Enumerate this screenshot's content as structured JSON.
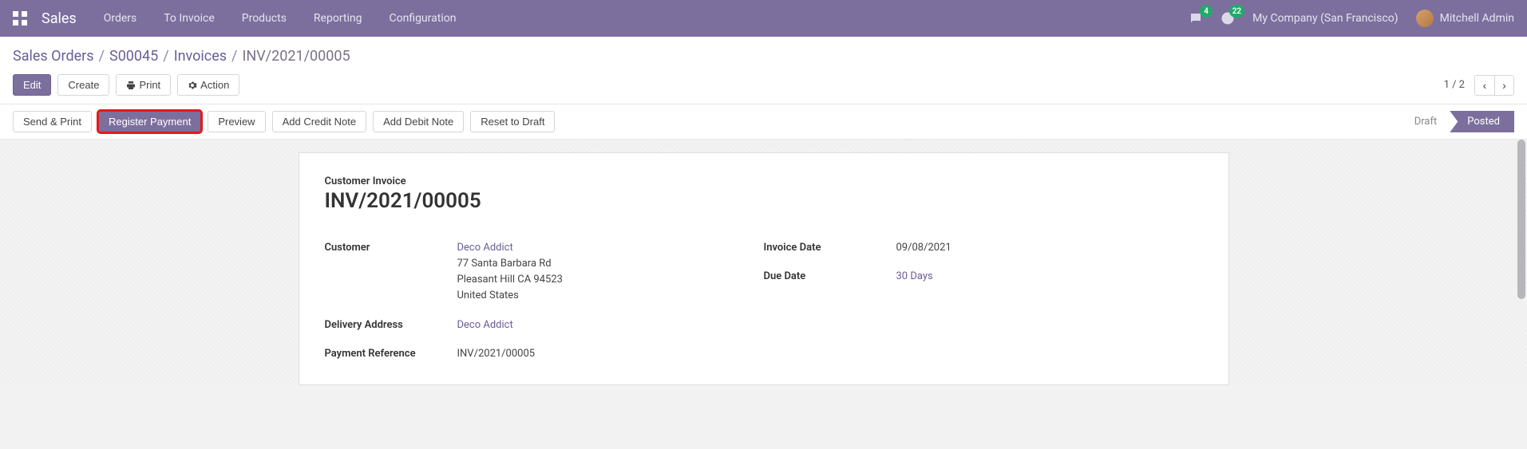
{
  "nav": {
    "brand": "Sales",
    "links": [
      "Orders",
      "To Invoice",
      "Products",
      "Reporting",
      "Configuration"
    ],
    "chat_badge": "4",
    "clock_badge": "22",
    "company": "My Company (San Francisco)",
    "user": "Mitchell Admin"
  },
  "breadcrumb": {
    "items": [
      "Sales Orders",
      "S00045",
      "Invoices"
    ],
    "current": "INV/2021/00005"
  },
  "ctrl": {
    "edit": "Edit",
    "create": "Create",
    "print": "Print",
    "action": "Action",
    "page": "1 / 2"
  },
  "actions": {
    "send_print": "Send & Print",
    "register_payment": "Register Payment",
    "preview": "Preview",
    "add_credit": "Add Credit Note",
    "add_debit": "Add Debit Note",
    "reset": "Reset to Draft"
  },
  "status": {
    "draft": "Draft",
    "posted": "Posted"
  },
  "form": {
    "doc_type": "Customer Invoice",
    "doc_name": "INV/2021/00005",
    "labels": {
      "customer": "Customer",
      "delivery_address": "Delivery Address",
      "payment_reference": "Payment Reference",
      "invoice_date": "Invoice Date",
      "due_date": "Due Date"
    },
    "customer": {
      "name": "Deco Addict",
      "street": "77 Santa Barbara Rd",
      "city_line": "Pleasant Hill CA 94523",
      "country": "United States"
    },
    "delivery_address": "Deco Addict",
    "payment_reference": "INV/2021/00005",
    "invoice_date": "09/08/2021",
    "due_date": "30 Days"
  }
}
